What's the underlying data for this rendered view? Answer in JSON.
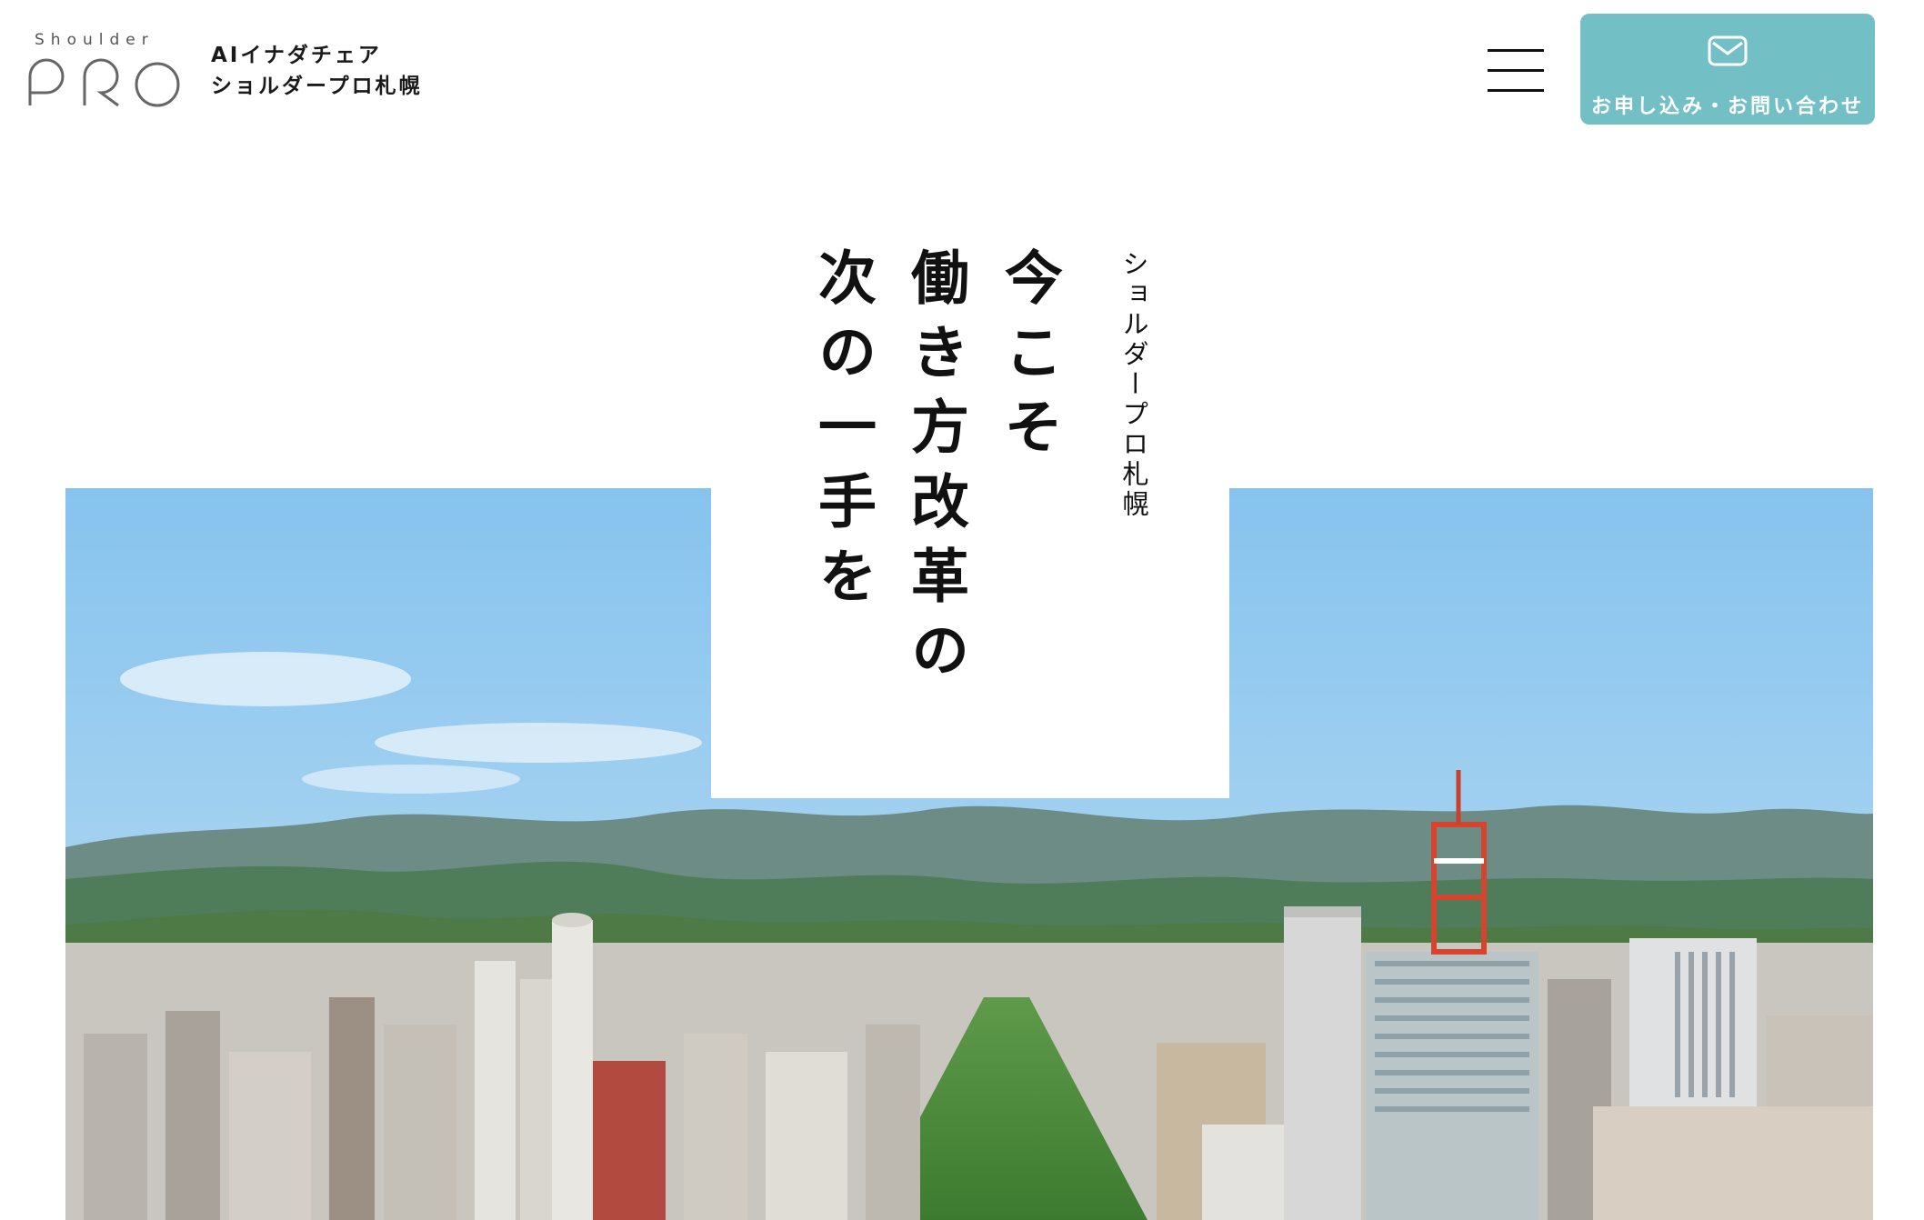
{
  "header": {
    "logo_small_text": "Shoulder",
    "logo_big_text": "PRO",
    "site_name_line1": "AIイナダチェア",
    "site_name_line2": "ショルダープロ札幌",
    "menu_icon": "hamburger-menu-icon",
    "contact_button_label": "お申し込み・お問い合わせ",
    "contact_icon": "mail-icon"
  },
  "hero": {
    "subtitle": "ショルダープロ札幌",
    "headline_columns": [
      "今こそ",
      "働き方改革の",
      "次の一手を"
    ],
    "image_subject": "sapporo-city-aerial-photo"
  },
  "colors": {
    "accent": "#72c0c6",
    "text": "#111111",
    "background": "#ffffff",
    "sky": "#7fbde8"
  }
}
